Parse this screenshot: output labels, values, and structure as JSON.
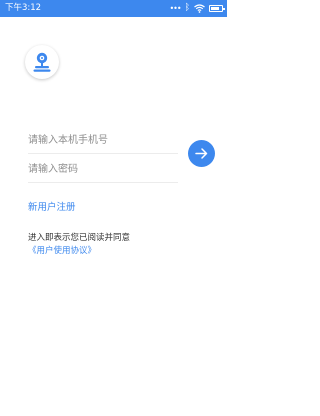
{
  "status_bar": {
    "time": "下午3:12",
    "background": "#3d88ee",
    "icons": [
      "more-dots-icon",
      "bluetooth-icon",
      "wifi-icon",
      "battery-icon"
    ]
  },
  "logo": {
    "icon": "camera-logo-icon"
  },
  "login_form": {
    "phone_placeholder": "请输入本机手机号",
    "password_placeholder": "请输入密码",
    "submit_icon": "arrow-right-icon"
  },
  "register_link": "新用户注册",
  "agreement": {
    "text": "进入即表示您已阅读并同意",
    "link": "《用户使用协议》"
  },
  "colors": {
    "accent": "#3d88ee",
    "text": "#333333",
    "placeholder": "#8e8e8e"
  }
}
